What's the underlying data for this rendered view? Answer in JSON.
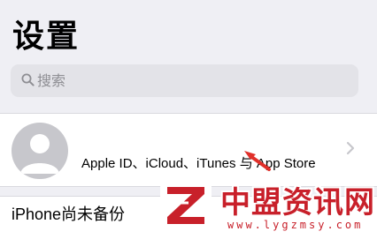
{
  "header": {
    "title": "设置"
  },
  "search": {
    "placeholder": "搜索",
    "value": ""
  },
  "account": {
    "subtitle": "Apple ID、iCloud、iTunes 与 App Store"
  },
  "backup": {
    "label": "iPhone尚未备份"
  },
  "watermark": {
    "name": "中盟资讯网",
    "url": "www.lygzmsy.com",
    "logo_letter": "Z"
  },
  "colors": {
    "background": "#efeff4",
    "row": "#ffffff",
    "search_bar": "#e3e3e8",
    "secondary_text": "#8e8e93",
    "annotation_red": "#e0302a",
    "watermark_red": "#c8202a"
  },
  "icons": [
    "search-icon",
    "avatar-person-icon",
    "chevron-right-icon",
    "annotation-arrow-icon",
    "watermark-logo-icon"
  ]
}
